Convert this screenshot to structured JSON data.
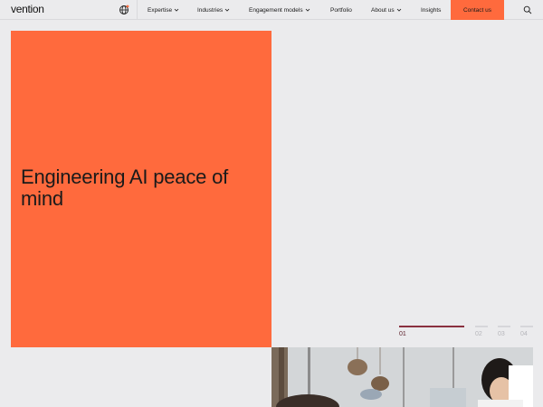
{
  "brand": {
    "logo_text": "vention",
    "accent": "#ff6a3d"
  },
  "nav": {
    "globe_icon": "globe-icon",
    "items": [
      {
        "label": "Expertise",
        "has_dropdown": true
      },
      {
        "label": "Industries",
        "has_dropdown": true
      },
      {
        "label": "Engagement models",
        "has_dropdown": true
      },
      {
        "label": "Portfolio",
        "has_dropdown": false
      },
      {
        "label": "About us",
        "has_dropdown": true
      },
      {
        "label": "Insights",
        "has_dropdown": false
      }
    ],
    "contact_label": "Contact us",
    "search_icon": "search-icon"
  },
  "hero": {
    "title": "Engineering AI peace of mind",
    "background": "#ff6a3d"
  },
  "slider": {
    "active": 0,
    "items": [
      {
        "label": "01"
      },
      {
        "label": "02"
      },
      {
        "label": "03"
      },
      {
        "label": "04"
      }
    ]
  }
}
